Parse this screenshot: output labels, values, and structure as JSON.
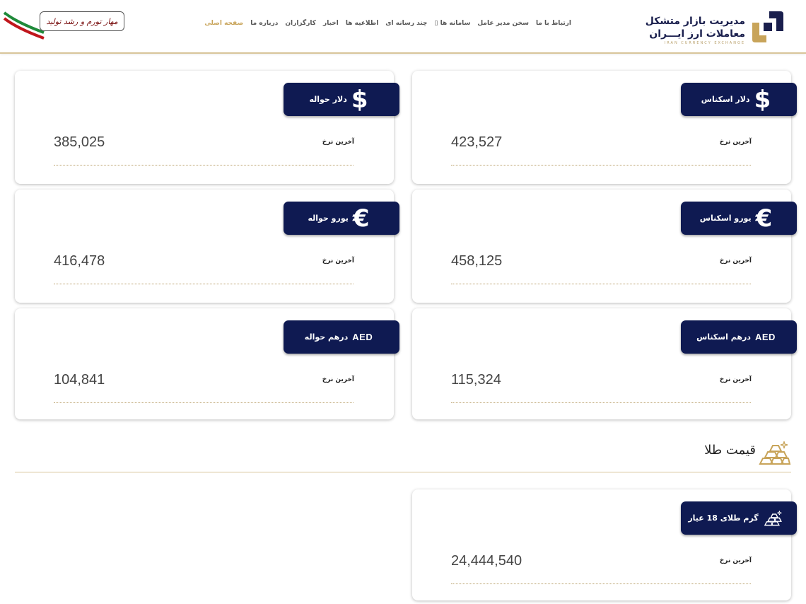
{
  "header": {
    "logo": {
      "line1": "مدیریت بازار متشکل",
      "line2": "معاملات ارز ایـــران",
      "sub": "IRAN CURRENCY EXCHANGE"
    },
    "nav": [
      {
        "label": "صفحه اصلی",
        "active": true
      },
      {
        "label": "درباره ما",
        "active": false
      },
      {
        "label": "کارگزاران",
        "active": false
      },
      {
        "label": "اخبار",
        "active": false
      },
      {
        "label": "اطلاعیه ها",
        "active": false
      },
      {
        "label": "چند رسانه ای",
        "active": false
      },
      {
        "label": "سامانه ها ▯",
        "active": false
      },
      {
        "label": "سخن مدیر عامل",
        "active": false
      },
      {
        "label": "ارتباط با ما",
        "active": false
      }
    ],
    "slogan": "مهار تورم و رشد تولید"
  },
  "currencies": [
    {
      "name": "دلار اسکناس",
      "icon": "dollar-icon",
      "symbol": "$",
      "rate_label": "آخرین نرخ",
      "value": "423,527"
    },
    {
      "name": "دلار حواله",
      "icon": "dollar-icon",
      "symbol": "$",
      "rate_label": "آخرین نرخ",
      "value": "385,025"
    },
    {
      "name": "یورو اسکناس",
      "icon": "euro-icon",
      "symbol": "€",
      "rate_label": "آخرین نرخ",
      "value": "458,125"
    },
    {
      "name": "یورو حواله",
      "icon": "euro-icon",
      "symbol": "€",
      "rate_label": "آخرین نرخ",
      "value": "416,478"
    },
    {
      "name": "درهم اسکناس",
      "icon": "aed-icon",
      "symbol": "AED",
      "rate_label": "آخرین نرخ",
      "value": "115,324"
    },
    {
      "name": "درهم حواله",
      "icon": "aed-icon",
      "symbol": "AED",
      "rate_label": "آخرین نرخ",
      "value": "104,841"
    }
  ],
  "gold": {
    "section_title": "قیمت طلا",
    "icon": "gold-bars-icon",
    "items": [
      {
        "name": "گرم طلای 18 عیار",
        "icon": "gold-bars-icon",
        "rate_label": "آخرین نرخ",
        "value": "24,444,540"
      }
    ]
  },
  "colors": {
    "navy": "#0f1a52",
    "gold": "#c8a45a",
    "brand_text": "#1a1f4d"
  }
}
